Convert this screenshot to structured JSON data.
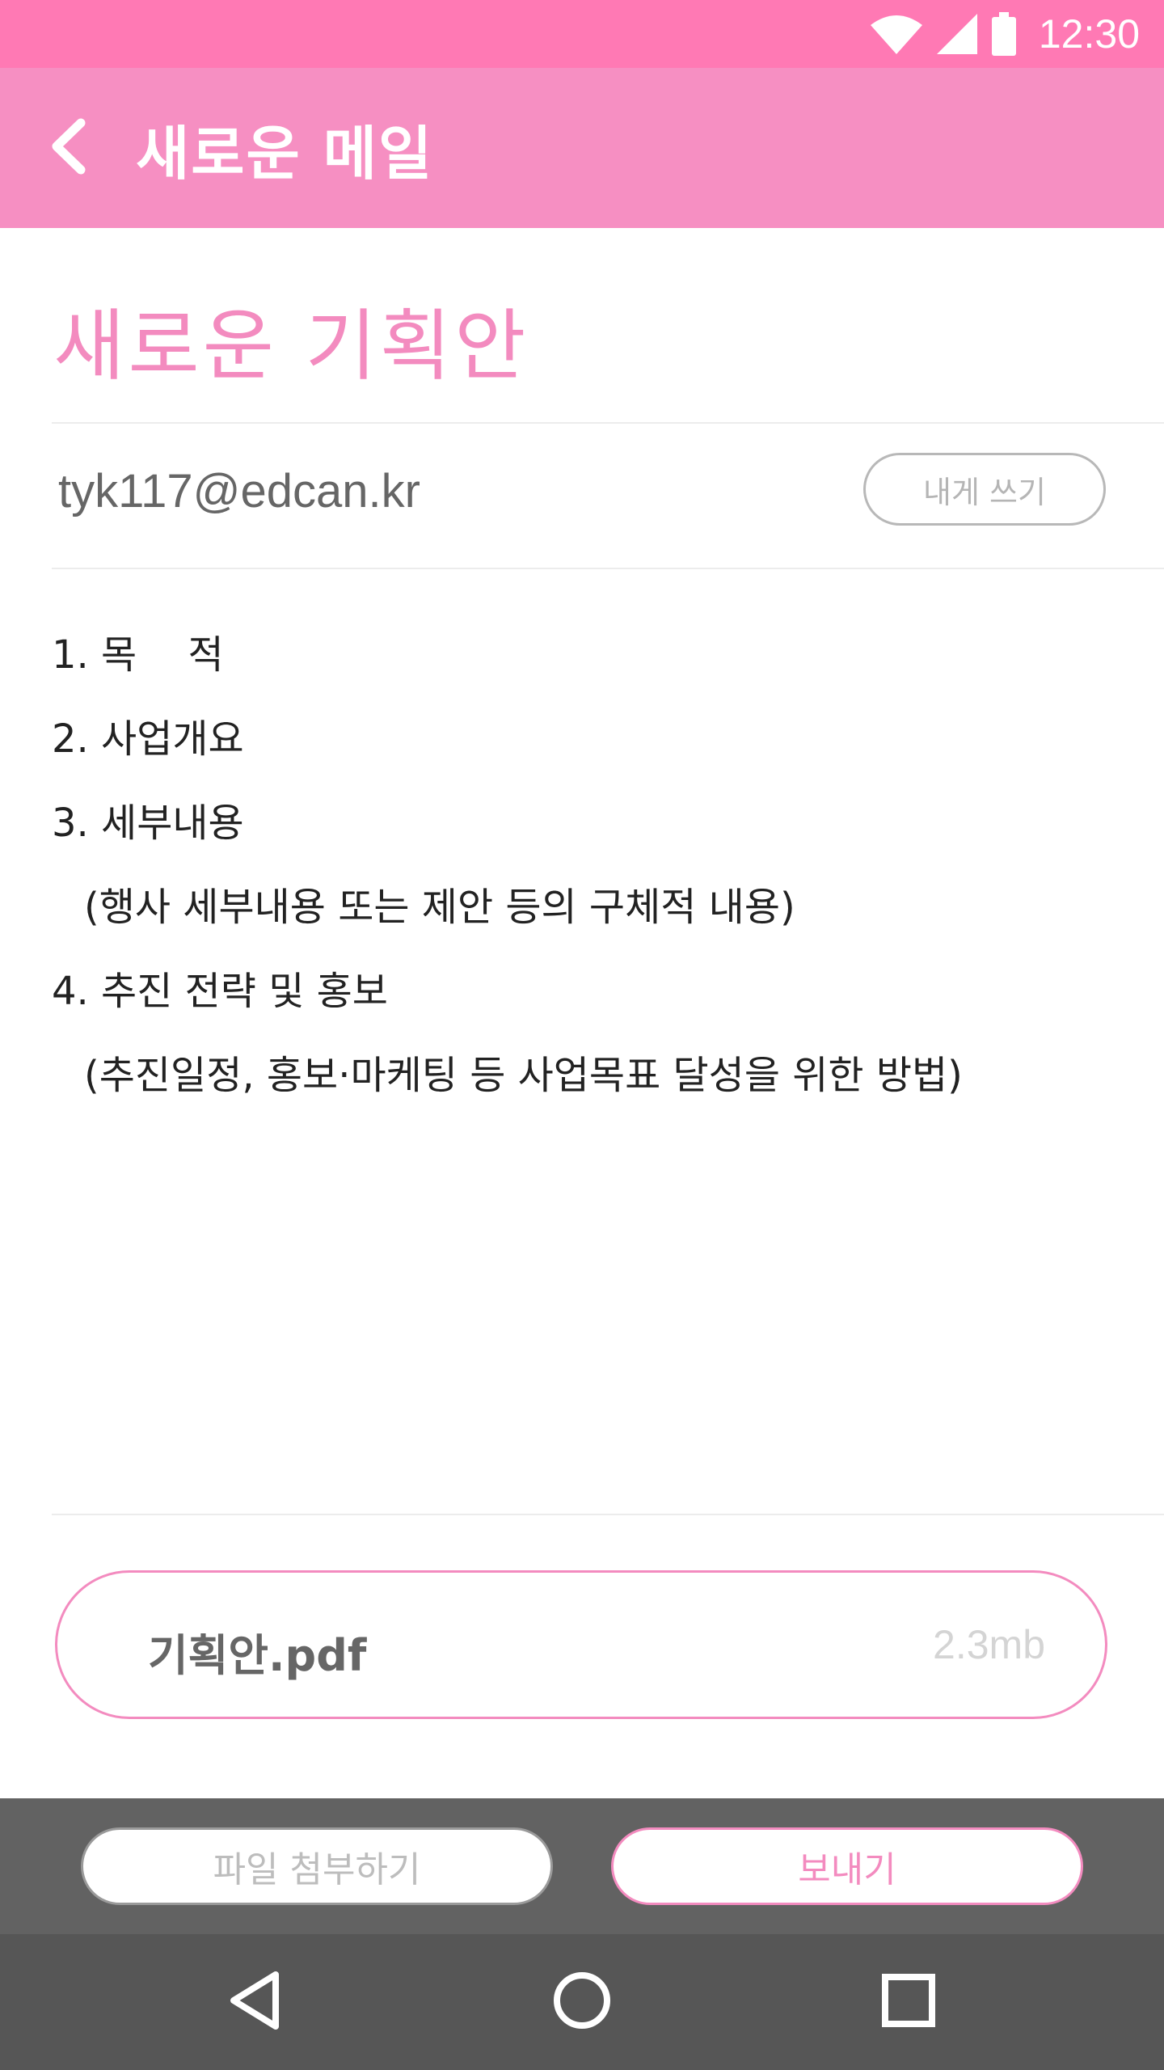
{
  "status_bar": {
    "time": "12:30",
    "icons": [
      "wifi-icon",
      "signal-icon",
      "battery-icon"
    ]
  },
  "app_bar": {
    "title": "새로운 메일",
    "back_icon": "chevron-left-icon"
  },
  "mail": {
    "subject": "새로운 기획안",
    "to": "tyk117@edcan.kr",
    "self_button_label": "내게 쓰기",
    "body_lines": [
      "1. 목　 적",
      "2. 사업개요",
      "3. 세부내용",
      "(행사 세부내용 또는 제안 등의 구체적 내용)",
      "4. 추진 전략 및 홍보",
      "(추진일정, 홍보·마케팅 등 사업목표 달성을 위한 방법)"
    ]
  },
  "attachment": {
    "name": "기획안.pdf",
    "size": "2.3mb"
  },
  "actions": {
    "attach_label": "파일 첨부하기",
    "send_label": "보내기"
  },
  "nav_bar": {
    "icons": [
      "back-triangle-icon",
      "home-circle-icon",
      "recents-square-icon"
    ]
  },
  "colors": {
    "status_bar": "#ff79b4",
    "app_bar": "#f68fc2",
    "accent": "#f38bbf",
    "action_bar": "#626262",
    "nav_bar": "#565656"
  }
}
